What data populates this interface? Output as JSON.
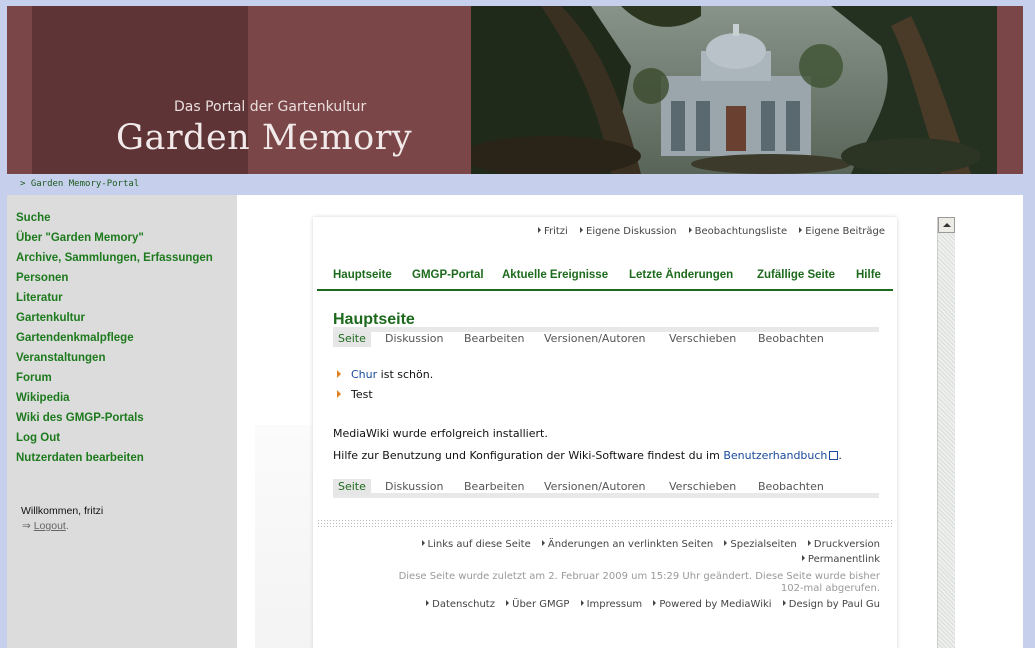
{
  "header": {
    "subtitle": "Das Portal der Gartenkultur",
    "title": "Garden Memory"
  },
  "breadcrumb": "> Garden Memory-Portal",
  "sidebar": {
    "items": [
      "Suche",
      "Über \"Garden Memory\"",
      "Archive, Sammlungen, Erfassungen",
      "Personen",
      "Literatur",
      "Gartenkultur",
      "Gartendenkmalpflege",
      "Veranstaltungen",
      "Forum",
      "Wikipedia",
      "Wiki des GMGP-Portals",
      "Log Out",
      "Nutzerdaten bearbeiten"
    ],
    "welcome": "Willkommen, fritzi",
    "logout_prefix": "⇒ ",
    "logout_link": "Logout",
    "logout_suffix": "."
  },
  "usernav": [
    "Fritzi",
    "Eigene Diskussion",
    "Beobachtungsliste",
    "Eigene Beiträge"
  ],
  "mainnav": [
    "Hauptseite",
    "GMGP-Portal",
    "Aktuelle Ereignisse",
    "Letzte Änderungen",
    "Zufällige Seite",
    "Hilfe"
  ],
  "page_title": "Hauptseite",
  "tabs": [
    "Seite",
    "Diskussion",
    "Bearbeiten",
    "Versionen/Autoren",
    "Verschieben",
    "Beobachten"
  ],
  "bullets": {
    "item1_link": "Chur",
    "item1_text": " ist schön.",
    "item2": "Test"
  },
  "body": {
    "para1": "MediaWiki wurde erfolgreich installiert.",
    "para2_prefix": "Hilfe zur Benutzung und Konfiguration der Wiki-Software findest du im ",
    "para2_link": "Benutzerhandbuch",
    "para2_suffix": "."
  },
  "footer": {
    "row1": [
      "Links auf diese Seite",
      "Änderungen an verlinkten Seiten",
      "Spezialseiten",
      "Druckversion"
    ],
    "row2": [
      "Permanentlink"
    ],
    "note1": "Diese Seite wurde zuletzt am 2. Februar 2009 um 15:29 Uhr geändert. Diese Seite wurde bisher",
    "note2": "102-mal abgerufen.",
    "row3": [
      "Datenschutz",
      "Über GMGP",
      "Impressum",
      "Powered by MediaWiki",
      "Design by Paul Gu"
    ]
  },
  "colors": {
    "header_bg": "#7b4647",
    "accent_green": "#1d6a1d",
    "page_bg": "#c6d0ec",
    "sidebar_bg": "#dcdcdc",
    "bullet_orange": "#e08020"
  }
}
